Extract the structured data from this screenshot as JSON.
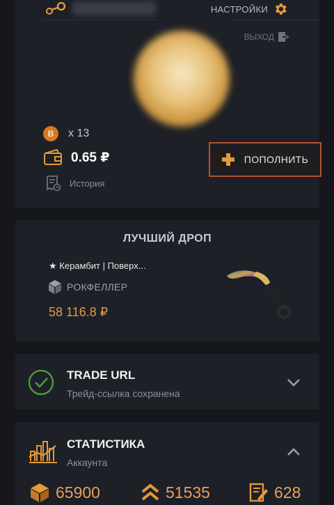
{
  "header": {
    "settings_label": "НАСТРОЙКИ",
    "logout_label": "ВЫХОД"
  },
  "profile": {
    "coin_symbol": "B",
    "coin_count": "x 13",
    "balance": "0.65 ₽",
    "history_label": "История",
    "topup_label": "ПОПОЛНИТЬ"
  },
  "best_drop": {
    "title": "ЛУЧШИЙ ДРОП",
    "item_name": "★ Керамбит | Поверх...",
    "case_name": "РОКФЕЛЛЕР",
    "price": "58 116.8 ₽"
  },
  "trade_url": {
    "title": "TRADE URL",
    "subtitle": "Трейд-ссылка сохранена"
  },
  "statistics": {
    "title": "СТАТИСТИКА",
    "subtitle": "Аккаунта",
    "cases_opened": "65900",
    "upgrades": "51535",
    "contracts": "628"
  },
  "colors": {
    "accent_orange": "#e09a4d",
    "button_border": "#b8502f",
    "success_green": "#4c9a3d",
    "card_bg": "#1d2026",
    "page_bg": "#15171c"
  },
  "icons": {
    "steam": "steam-icon",
    "settings": "gear-icon",
    "logout": "logout-icon",
    "coin": "coin-icon",
    "wallet": "wallet-icon",
    "history": "receipt-icon",
    "topup": "plus-icon",
    "case": "cube-icon",
    "trade_status": "check-circle-icon",
    "trade_toggle": "chevron-down-icon",
    "stats": "chart-icon",
    "stats_toggle": "chevron-up-icon",
    "cases_stat": "box-icon",
    "upgrades_stat": "double-chevron-up-icon",
    "contracts_stat": "contract-icon"
  }
}
